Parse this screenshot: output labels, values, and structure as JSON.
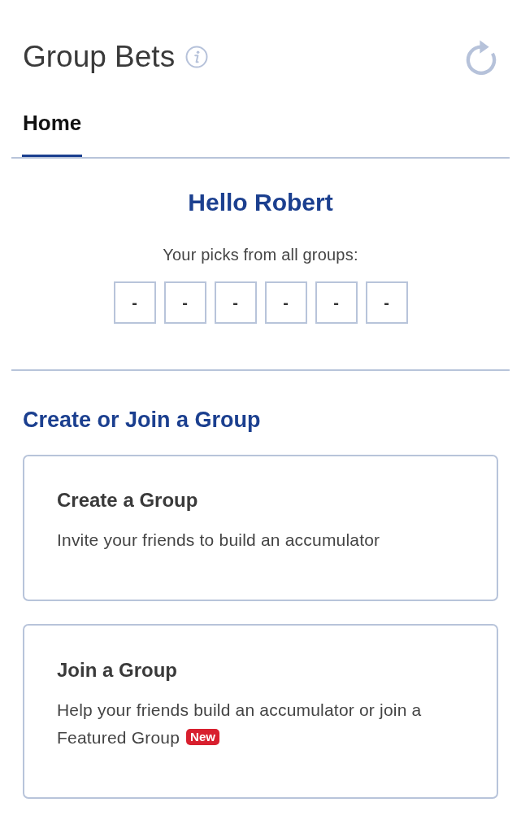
{
  "header": {
    "title": "Group Bets"
  },
  "tabs": [
    {
      "label": "Home",
      "selected": true
    }
  ],
  "greeting": {
    "title": "Hello Robert",
    "subtitle": "Your picks from all groups:",
    "picks": [
      "-",
      "-",
      "-",
      "-",
      "-",
      "-"
    ]
  },
  "section": {
    "title": "Create or Join a Group",
    "cards": [
      {
        "title": "Create a Group",
        "description": "Invite your friends to build an accumulator"
      },
      {
        "title": "Join a Group",
        "description": "Help your friends build an accumulator or join a Featured Group",
        "badge": "New"
      }
    ]
  }
}
